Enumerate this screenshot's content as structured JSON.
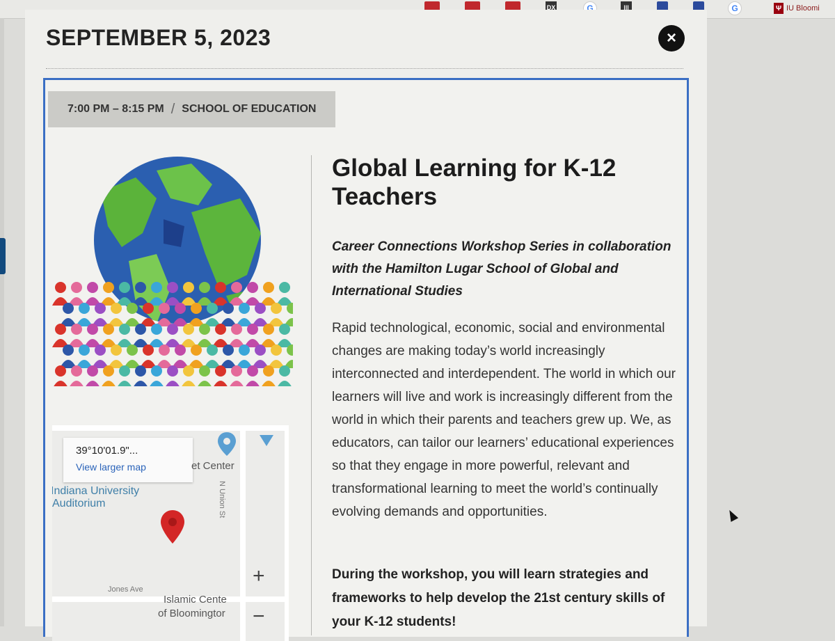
{
  "browser": {
    "extensions": [
      "google-icon",
      "google-icon",
      "google-icon"
    ],
    "iu_label": "IU Bloomi"
  },
  "modal": {
    "date": "SEPTEMBER 5, 2023",
    "close_label": "×"
  },
  "event": {
    "time": "7:00 PM – 8:15 PM",
    "separator": "/",
    "department": "SCHOOL OF EDUCATION",
    "title": "Global Learning for K-12 Teachers",
    "subtitle": "Career Connections Workshop Series in collaboration with the Hamilton Lugar School of Global and International Studies",
    "description": "Rapid technological, economic, social and environmental changes are making today’s world increasingly interconnected and interdependent. The world in which our learners will live and work is increasingly different from the world in which their parents and teachers grew up. We, as educators, can tailor our learners’ educational experiences so that they engage in more powerful, relevant and transformational learning to meet the world’s continually evolving demands and opportunities.",
    "workshop_intro": "During the workshop, you will learn strategies and frameworks to help develop the 21st century skills of your K-12 students!"
  },
  "map": {
    "coordinates": "39°10'01.9\"...",
    "view_larger": "View larger map",
    "place1_line1": "Indiana University",
    "place1_line2": "Auditorium",
    "place2": "et Center",
    "place3_line1": "Islamic Cente",
    "place3_line2": "of Bloomingtor",
    "street1": "N Union St",
    "street2": "Jones Ave",
    "zoom_in": "+",
    "zoom_out": "−"
  },
  "colors": {
    "accent_border": "#3b6fc4",
    "link": "#2a63b9",
    "pin": "#d32626",
    "iu_crimson": "#99000f"
  }
}
